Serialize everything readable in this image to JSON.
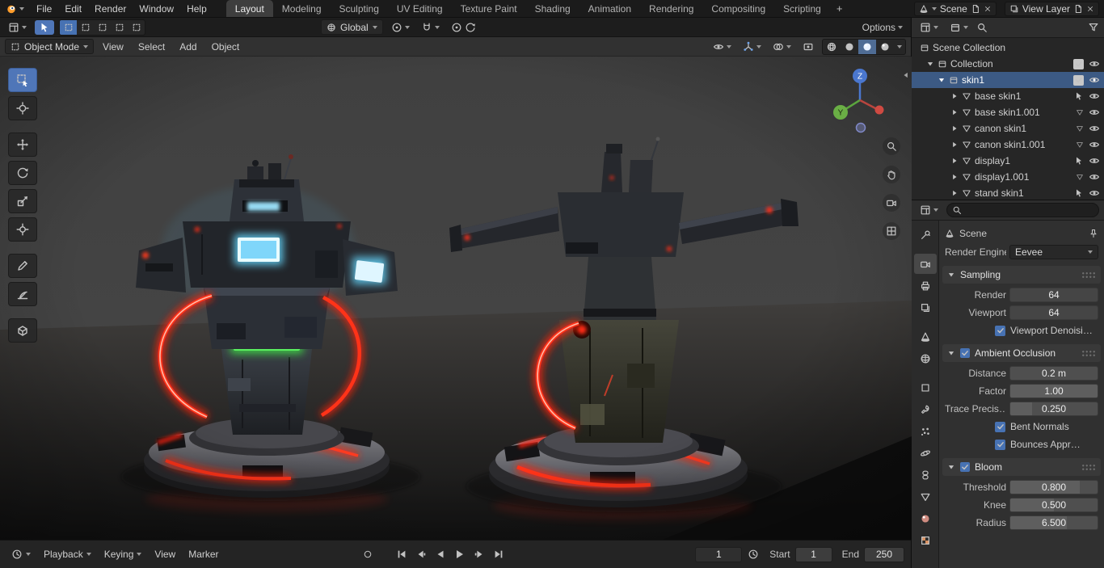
{
  "colors": {
    "accent": "#4772b3",
    "selected_row": "#3c5a84",
    "glow_red": "#ff2c18",
    "glow_blue": "#8fe0ff",
    "glow_green": "#4fe455"
  },
  "topbar": {
    "menus": [
      "File",
      "Edit",
      "Render",
      "Window",
      "Help"
    ],
    "tabs": [
      "Layout",
      "Modeling",
      "Sculpting",
      "UV Editing",
      "Texture Paint",
      "Shading",
      "Animation",
      "Rendering",
      "Compositing",
      "Scripting"
    ],
    "add_tab": "+",
    "scene_name": "Scene",
    "view_layer_name": "View Layer"
  },
  "tool_settings": {
    "orientation": "Global",
    "options": "Options"
  },
  "viewport": {
    "mode": "Object Mode",
    "menus": [
      "View",
      "Select",
      "Add",
      "Object"
    ],
    "gizmo": {
      "z": "Z",
      "y": "Y"
    }
  },
  "outliner": {
    "rows": [
      {
        "label": "Scene Collection"
      },
      {
        "label": "Collection"
      },
      {
        "label": "skin1"
      },
      {
        "label": "base skin1"
      },
      {
        "label": "base skin1.001"
      },
      {
        "label": "canon skin1"
      },
      {
        "label": "canon skin1.001"
      },
      {
        "label": "display1"
      },
      {
        "label": "display1.001"
      },
      {
        "label": "stand skin1"
      }
    ]
  },
  "properties": {
    "breadcrumb": "Scene",
    "render_engine": {
      "label": "Render Engine",
      "value": "Eevee"
    },
    "sampling": {
      "title": "Sampling",
      "rows": [
        {
          "label": "Render",
          "value": "64"
        },
        {
          "label": "Viewport",
          "value": "64"
        }
      ],
      "denoise": "Viewport Denoisi…"
    },
    "ao": {
      "title": "Ambient Occlusion",
      "rows": [
        {
          "label": "Distance",
          "value": "0.2 m"
        },
        {
          "label": "Factor",
          "value": "1.00"
        },
        {
          "label": "Trace Precis…",
          "value": "0.250"
        }
      ],
      "checks": [
        "Bent Normals",
        "Bounces Appr…"
      ]
    },
    "bloom": {
      "title": "Bloom",
      "rows": [
        {
          "label": "Threshold",
          "value": "0.800"
        },
        {
          "label": "Knee",
          "value": "0.500"
        },
        {
          "label": "Radius",
          "value": "6.500"
        }
      ]
    }
  },
  "timeline": {
    "menus": [
      "Playback",
      "Keying",
      "View",
      "Marker"
    ],
    "current_frame": "1",
    "start_label": "Start",
    "start_value": "1",
    "end_label": "End",
    "end_value": "250"
  }
}
